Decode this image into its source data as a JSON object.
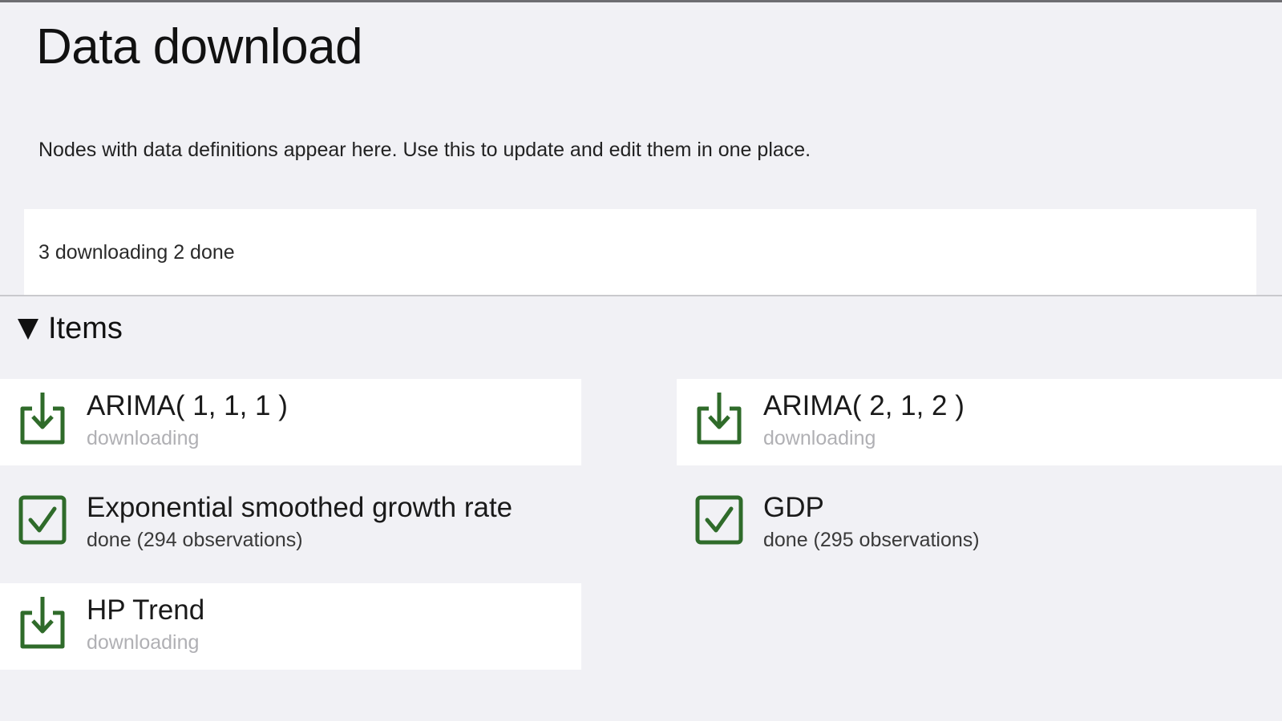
{
  "page": {
    "title": "Data download",
    "description": "Nodes with data definitions appear here. Use this to update and edit them in one place.",
    "status_summary": "3 downloading 2 done"
  },
  "items_section": {
    "label": "Items",
    "expanded": true,
    "entries": [
      {
        "name": "ARIMA( 1, 1, 1 )",
        "status": "downloading",
        "icon": "download-icon"
      },
      {
        "name": "ARIMA( 2, 1, 2 )",
        "status": "downloading",
        "icon": "download-icon"
      },
      {
        "name": "Exponential smoothed growth rate",
        "status": "done (294 observations)",
        "icon": "checkbox-checked-icon"
      },
      {
        "name": "GDP",
        "status": "done (295 observations)",
        "icon": "checkbox-checked-icon"
      },
      {
        "name": "HP Trend",
        "status": "downloading",
        "icon": "download-icon"
      }
    ]
  },
  "colors": {
    "background": "#f1f1f5",
    "card": "#ffffff",
    "icon_green": "#2f6b2a",
    "muted_text": "#b0b0b4"
  }
}
